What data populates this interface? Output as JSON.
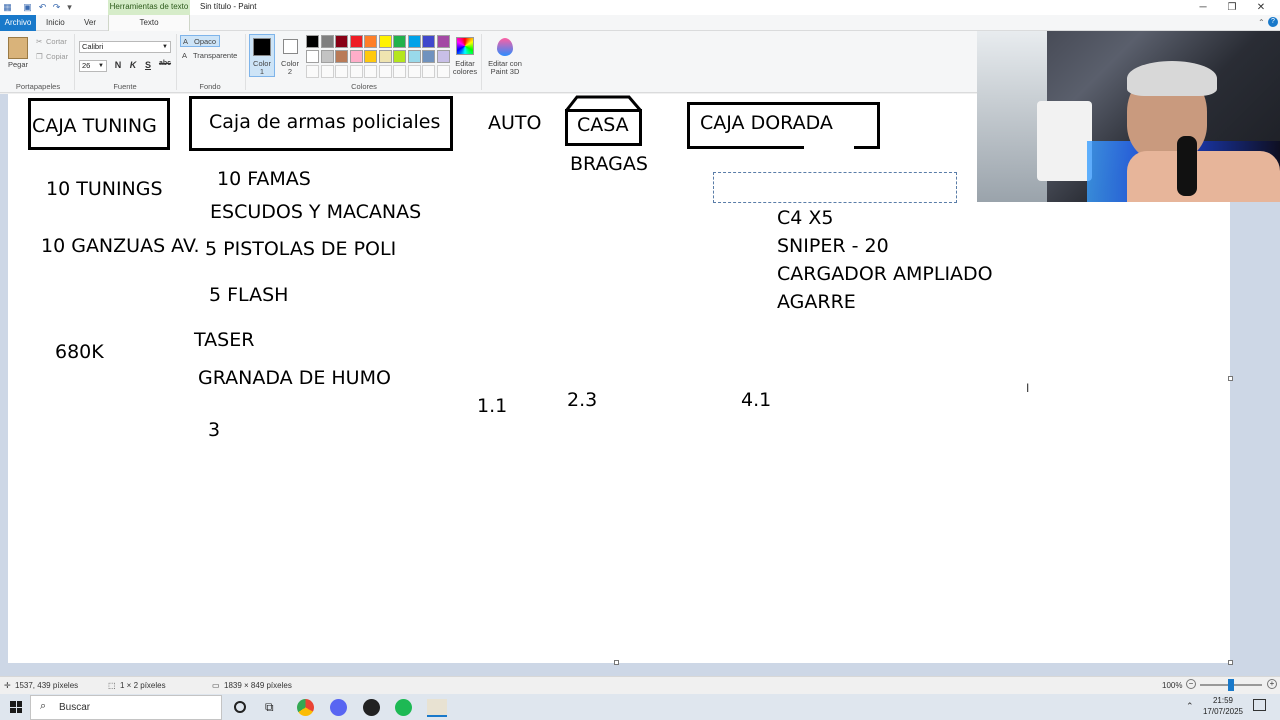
{
  "window": {
    "title": "Sin título - Paint",
    "context_tab": "Herramientas de texto"
  },
  "tabs": [
    "Archivo",
    "Inicio",
    "Ver",
    "Texto"
  ],
  "ribbon": {
    "clipboard": {
      "paste": "Pegar",
      "cut": "Cortar",
      "copy": "Copiar",
      "label": "Portapapeles"
    },
    "font": {
      "family": "Calibri",
      "size": "26",
      "bold": "N",
      "italic": "K",
      "underline": "S",
      "strike": "abc",
      "label": "Fuente"
    },
    "background": {
      "opaque": "Opaco",
      "transparent": "Transparente",
      "label": "Fondo"
    },
    "color1": "Color 1",
    "color2": "Color 2",
    "colors_label": "Colores",
    "edit_colors": "Editar colores",
    "edit_paint3d": "Editar con Paint 3D",
    "palette": [
      "#000000",
      "#7f7f7f",
      "#880015",
      "#ed1c24",
      "#ff7f27",
      "#fff200",
      "#22b14c",
      "#00a2e8",
      "#3f48cc",
      "#a349a4",
      "#ffffff",
      "#c3c3c3",
      "#b97a57",
      "#ffaec9",
      "#ffc90e",
      "#efe4b0",
      "#b5e61d",
      "#99d9ea",
      "#7092be",
      "#c8bfe7"
    ]
  },
  "canvas": {
    "texts": {
      "caja_tuning": "CAJA TUNING",
      "caja_armas": "Caja de armas policiales",
      "auto": "AUTO",
      "casa": "CASA",
      "caja_dorada": "CAJA DORADA",
      "tunings": "10 TUNINGS",
      "ganzuas": "10 GANZUAS AV.",
      "price_680k": "680K",
      "famas": "10 FAMAS",
      "escudos": "ESCUDOS Y MACANAS",
      "pistolas": "5 PISTOLAS DE POLI",
      "flash": "5 FLASH",
      "taser": "TASER",
      "granada": "GRANADA DE HUMO",
      "three": "3",
      "v11": "1.1",
      "bragas": "BRAGAS",
      "v23": "2.3",
      "c4": "C4 X5",
      "sniper": "SNIPER - 20",
      "cargador": "CARGADOR AMPLIADO",
      "agarre": "AGARRE",
      "v41": "4.1"
    }
  },
  "status": {
    "cursor_pos": "1537, 439 píxeles",
    "selection_size": "1 × 2 píxeles",
    "image_size": "1839 × 849 píxeles",
    "zoom": "100%"
  },
  "taskbar": {
    "search_placeholder": "Buscar",
    "time": "21:59",
    "date": "17/07/2025"
  }
}
